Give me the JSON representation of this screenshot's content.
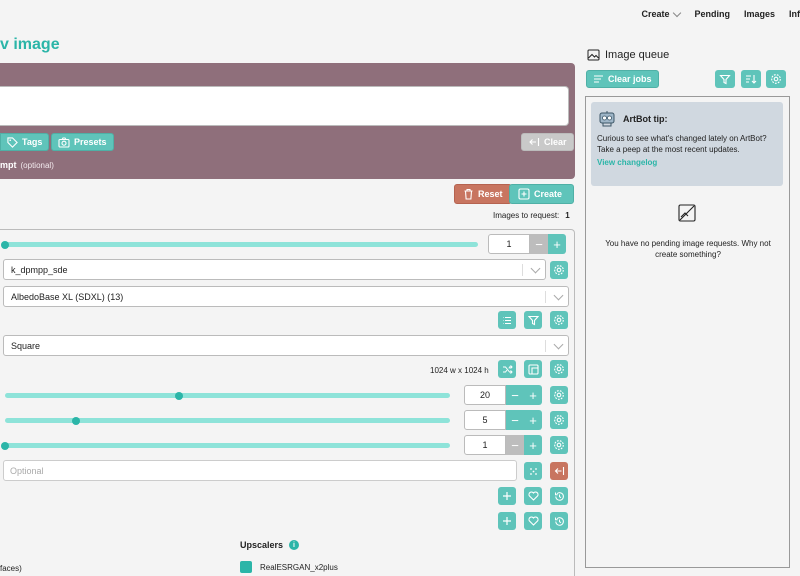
{
  "nav": {
    "create": "Create",
    "pending": "Pending",
    "images": "Images",
    "info": "Inf"
  },
  "page_title": "v image",
  "prompt": {
    "tags_label": "Tags",
    "presets_label": "Presets",
    "clear_label": "Clear",
    "negative_label": "mpt",
    "negative_optional": "(optional)"
  },
  "actions": {
    "reset_label": "Reset",
    "create_label": "Create"
  },
  "images_to_request": {
    "label": "Images to request:",
    "value": "1"
  },
  "settings": {
    "images_count": {
      "value": "1",
      "fraction": 0.0
    },
    "sampler": "k_dpmpp_sde",
    "model": "AlbedoBase XL (SDXL) (13)",
    "aspect": "Square",
    "dimensions": "1024 w x 1024 h",
    "steps": {
      "value": "20",
      "fraction": 0.39
    },
    "cfg": {
      "value": "5",
      "fraction": 0.16
    },
    "clip": {
      "value": "1",
      "fraction": 0.0
    },
    "seed_placeholder": "Optional"
  },
  "upscalers": {
    "title": "Upscalers",
    "info": "i",
    "faces_label": "faces)",
    "esrgan_label": "RealESRGAN_x2plus"
  },
  "queue": {
    "title": "Image queue",
    "clear_jobs_label": "Clear jobs",
    "tip_title": "ArtBot tip:",
    "tip_body": "Curious to see what's changed lately on ArtBot? Take a peep at the most recent updates.",
    "tip_link": "View changelog",
    "empty_text": "You have no pending image requests. Why not create something?"
  },
  "colors": {
    "accent": "#2bb5a8",
    "button": "#5fc4ba",
    "prompt_bg": "#8f6f7b",
    "danger": "#c87560",
    "tip_bg": "#d0d8e0"
  }
}
